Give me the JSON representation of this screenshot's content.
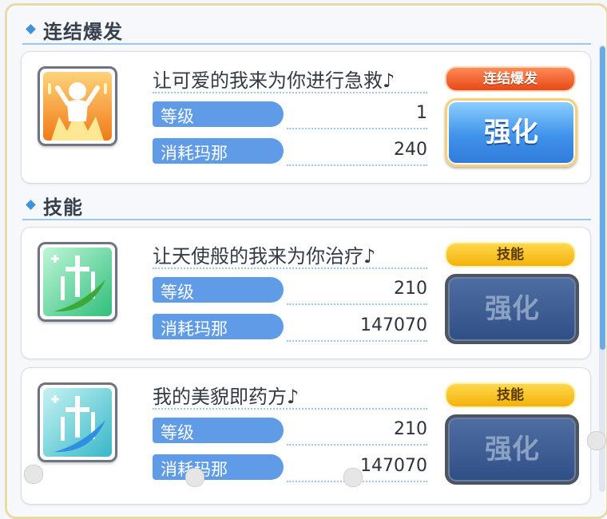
{
  "sections": {
    "union_burst": {
      "title": "连结爆发"
    },
    "skills": {
      "title": "技能"
    }
  },
  "cards": [
    {
      "name": "让可爱的我来为你进行急救♪",
      "badge": "连结爆发",
      "level_label": "等级",
      "level_value": "1",
      "cost_label": "消耗玛那",
      "cost_value": "240",
      "button_label": "强化",
      "button_state": "active",
      "icon": "union-burst-cheer-icon"
    },
    {
      "name": "让天使般的我来为你治疗♪",
      "badge": "技能",
      "level_label": "等级",
      "level_value": "210",
      "cost_label": "消耗玛那",
      "cost_value": "147070",
      "button_label": "强化",
      "button_state": "disabled",
      "icon": "heal-sparkle-green-icon"
    },
    {
      "name": "我的美貌即药方♪",
      "badge": "技能",
      "level_label": "等级",
      "level_value": "210",
      "cost_label": "消耗玛那",
      "cost_value": "147070",
      "button_label": "强化",
      "button_state": "disabled",
      "icon": "heal-sparkle-blue-icon"
    }
  ],
  "colors": {
    "label_bar": "#5f9be6",
    "union_badge": "#e74818",
    "skill_badge": "#f3b20c",
    "active_button": "#3f93ea",
    "disabled_button": "#2e4e86"
  }
}
